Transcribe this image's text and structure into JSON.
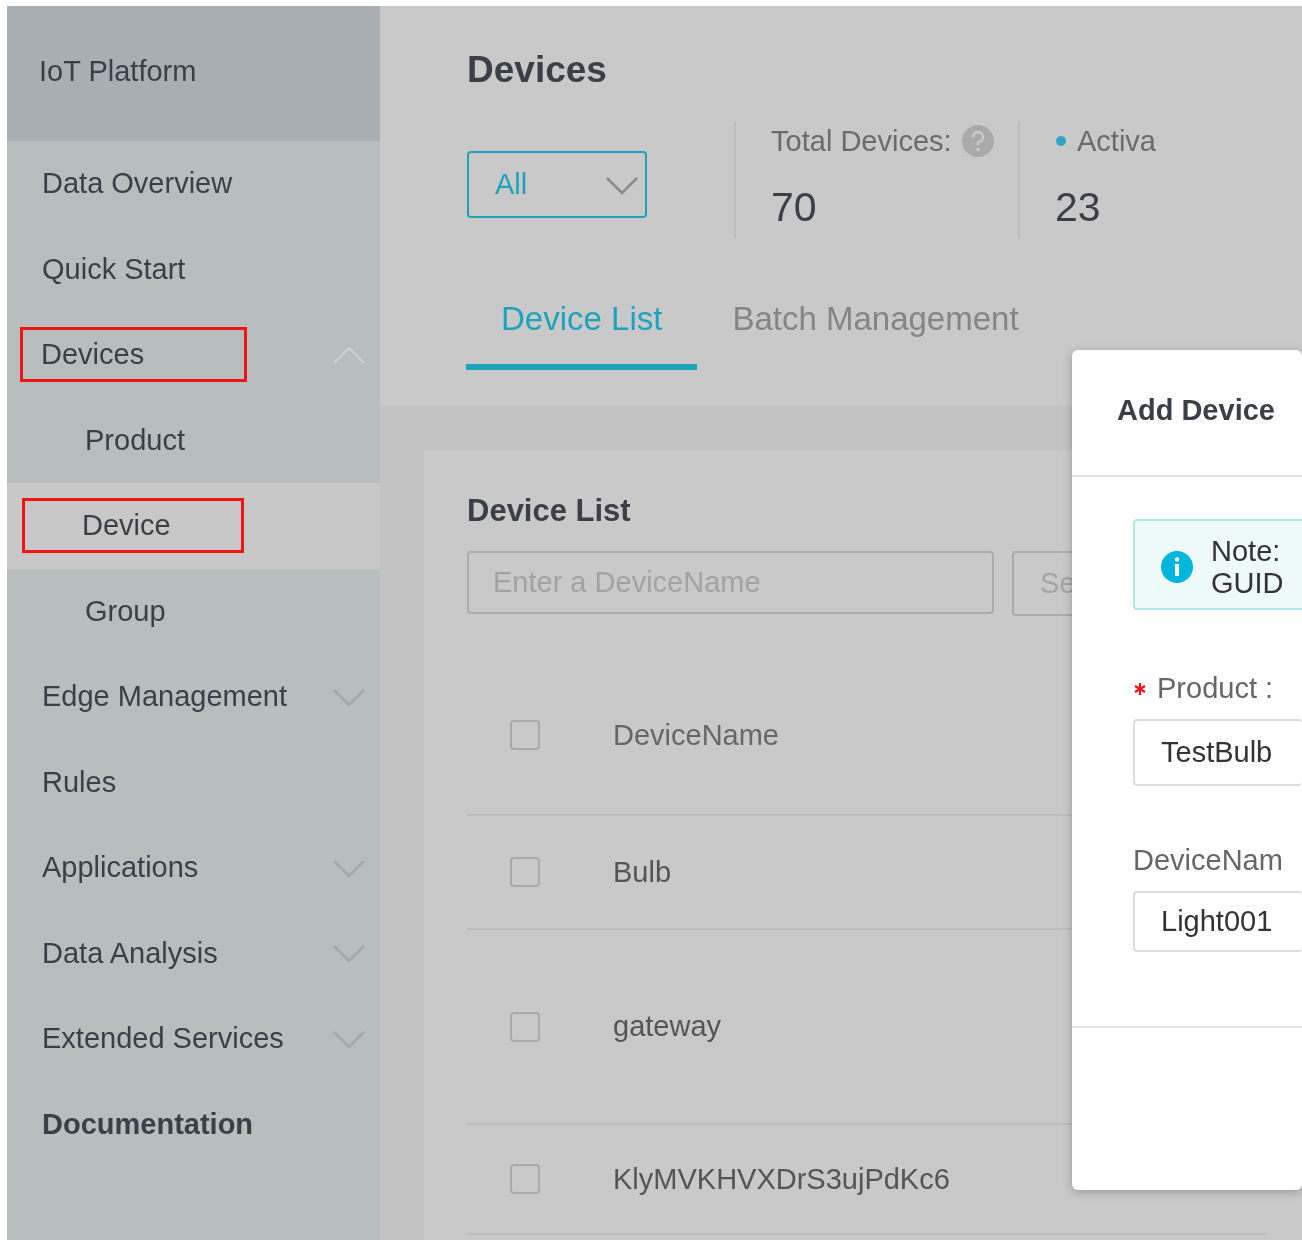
{
  "sidebar": {
    "title": "IoT Platform",
    "items": [
      {
        "label": "Data Overview",
        "kind": "item",
        "selected": false,
        "annotated": false
      },
      {
        "label": "Quick Start",
        "kind": "item",
        "selected": false,
        "annotated": false
      },
      {
        "label": "Devices",
        "kind": "item",
        "selected": false,
        "annotated": true,
        "expanded": true,
        "children": [
          {
            "label": "Product",
            "selected": false,
            "annotated": false
          },
          {
            "label": "Device",
            "selected": true,
            "annotated": true
          },
          {
            "label": "Group",
            "selected": false,
            "annotated": false
          }
        ]
      },
      {
        "label": "Edge Management",
        "kind": "item",
        "selected": false,
        "annotated": false,
        "expanded": false
      },
      {
        "label": "Rules",
        "kind": "item",
        "selected": false,
        "annotated": false
      },
      {
        "label": "Applications",
        "kind": "item",
        "selected": false,
        "annotated": false,
        "expanded": false
      },
      {
        "label": "Data Analysis",
        "kind": "item",
        "selected": false,
        "annotated": false,
        "expanded": false
      },
      {
        "label": "Extended Services",
        "kind": "item",
        "selected": false,
        "annotated": false,
        "expanded": false
      },
      {
        "label": "Documentation",
        "kind": "heading",
        "selected": false,
        "annotated": false
      }
    ]
  },
  "main": {
    "title": "Devices",
    "filter": {
      "value": "All"
    },
    "stats": [
      {
        "label": "Total Devices:",
        "value": "70",
        "kind": "help"
      },
      {
        "label": "Activa",
        "value": "23",
        "kind": "dot"
      }
    ],
    "tabs": [
      {
        "label": "Device List",
        "selected": true
      },
      {
        "label": "Batch Management",
        "selected": false
      }
    ],
    "card": {
      "title": "Device List",
      "search": {
        "placeholder": "Enter a DeviceName"
      },
      "search_button": "Se",
      "table": {
        "columns": [
          "DeviceName"
        ],
        "header_checked": false,
        "rows": [
          {
            "cells": [
              "Bulb"
            ],
            "checked": false
          },
          {
            "cells": [
              "gateway"
            ],
            "checked": false
          },
          {
            "cells": [
              "KlyMVKHVXDrS3ujPdKc6"
            ],
            "checked": false
          }
        ]
      }
    }
  },
  "dialog": {
    "title": "Add Device",
    "note": [
      "Note:",
      "GUID"
    ],
    "fields": [
      {
        "label": "Product :",
        "required": true,
        "value": "TestBulb"
      },
      {
        "label": "DeviceNam",
        "required": false,
        "value": "Light001"
      }
    ]
  }
}
